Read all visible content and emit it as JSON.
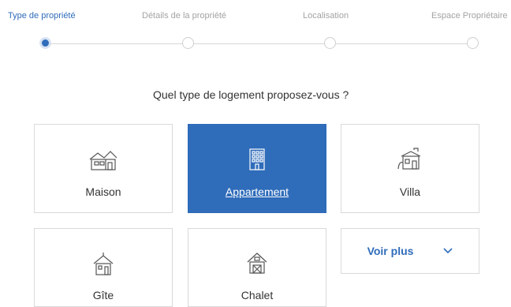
{
  "stepper": {
    "steps": [
      {
        "label": "Type de propriété",
        "active": true
      },
      {
        "label": "Détails de la propriété",
        "active": false
      },
      {
        "label": "Localisation",
        "active": false
      },
      {
        "label": "Espace Propriétaire",
        "active": false
      }
    ]
  },
  "question": "Quel type de logement proposez-vous ?",
  "cards": [
    {
      "label": "Maison",
      "icon": "house-icon",
      "selected": false
    },
    {
      "label": "Appartement",
      "icon": "apartment-building-icon",
      "selected": true
    },
    {
      "label": "Villa",
      "icon": "villa-icon",
      "selected": false
    },
    {
      "label": "Gîte",
      "icon": "gite-icon",
      "selected": false
    },
    {
      "label": "Chalet",
      "icon": "chalet-icon",
      "selected": false
    }
  ],
  "more": {
    "label": "Voir plus",
    "icon": "chevron-down-icon"
  },
  "colors": {
    "accent": "#2f6cba",
    "border": "#d9d9d9",
    "muted": "#a3a3a3"
  }
}
